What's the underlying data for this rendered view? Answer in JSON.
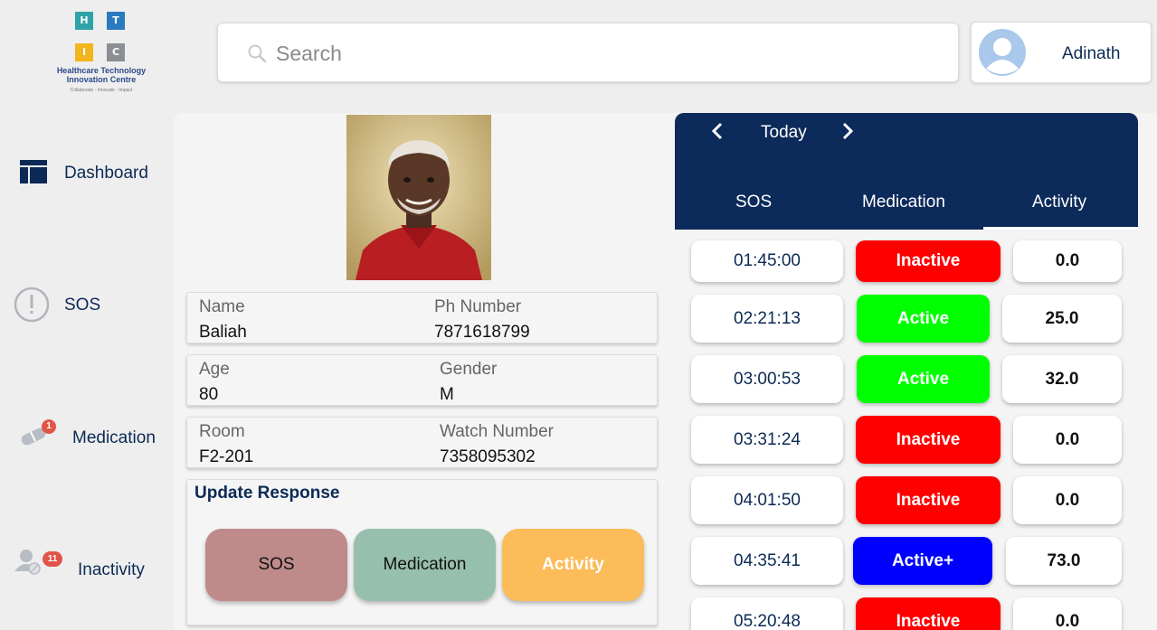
{
  "logo": {
    "letters": [
      "H",
      "T",
      "I",
      "C"
    ],
    "name": "Healthcare Technology Innovation Centre",
    "tagline": "Collaborate · Innovate · Impact"
  },
  "search": {
    "placeholder": "Search",
    "icon": "search-icon"
  },
  "user": {
    "name": "Adinath",
    "icon": "avatar-icon"
  },
  "sidebar": {
    "items": [
      {
        "label": "Dashboard",
        "icon": "dashboard-icon"
      },
      {
        "label": "SOS",
        "icon": "alert-circle-icon"
      },
      {
        "label": "Medication",
        "icon": "pill-icon",
        "badge": "1"
      },
      {
        "label": "Inactivity",
        "icon": "inactive-user-icon",
        "badge": "11"
      }
    ]
  },
  "patient": {
    "name_label": "Name",
    "name": "Baliah",
    "phone_label": "Ph Number",
    "phone": "7871618799",
    "age_label": "Age",
    "age": "80",
    "gender_label": "Gender",
    "gender": "M",
    "room_label": "Room",
    "room": "F2-201",
    "watch_label": "Watch Number",
    "watch": "7358095302"
  },
  "response": {
    "title": "Update Response",
    "buttons": [
      {
        "label": "SOS",
        "color": "#bf8a8a"
      },
      {
        "label": "Medication",
        "color": "#97bfae"
      },
      {
        "label": "Activity",
        "color": "#fcbc5a"
      }
    ]
  },
  "history": {
    "date_label": "Today",
    "tabs": [
      "SOS",
      "Medication",
      "Activity"
    ],
    "active_tab": "Activity",
    "header_color": "#0c2a5a",
    "rows": [
      {
        "time": "01:45:00",
        "status": "Inactive",
        "value": "0.0"
      },
      {
        "time": "02:21:13",
        "status": "Active",
        "value": "25.0"
      },
      {
        "time": "03:00:53",
        "status": "Active",
        "value": "32.0"
      },
      {
        "time": "03:31:24",
        "status": "Inactive",
        "value": "0.0"
      },
      {
        "time": "04:01:50",
        "status": "Inactive",
        "value": "0.0"
      },
      {
        "time": "04:35:41",
        "status": "Active+",
        "value": "73.0"
      },
      {
        "time": "05:20:48",
        "status": "Inactive",
        "value": "0.0"
      }
    ],
    "status_colors": {
      "Inactive": "#ff0000",
      "Active": "#00ff00",
      "Active+": "#0000ff"
    }
  }
}
